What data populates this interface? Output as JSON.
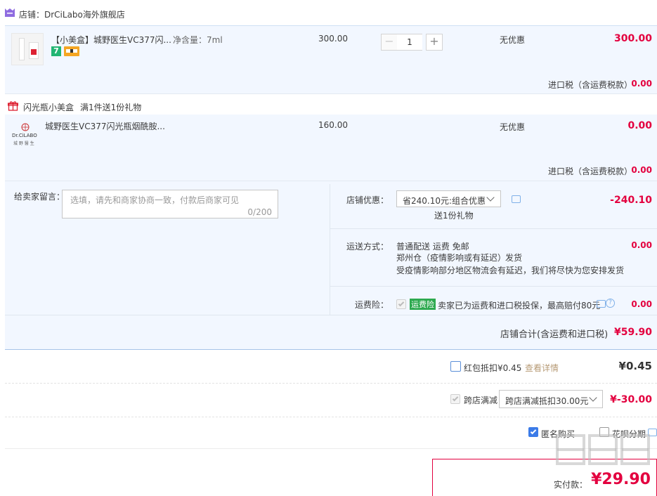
{
  "shop": {
    "name": "店铺：DrCiLabo海外旗舰店"
  },
  "items": [
    {
      "title": "【小美盒】城野医生VC377闪...",
      "spec": "净含量：7ml",
      "price": "300.00",
      "quantity": "1",
      "discount": "无优惠",
      "subtotal": "300.00",
      "tax_label": "进口税（含运费税款）",
      "tax_value": "0.00",
      "tag_number": "7"
    },
    {
      "promo_label": "闪光瓶小美盒",
      "promo_rule": "满1件送1份礼物",
      "title": "城野医生VC377闪光瓶烟酰胺...",
      "price": "160.00",
      "discount": "无优惠",
      "subtotal": "0.00",
      "tax_label": "进口税（含运费税款）",
      "tax_value": "0.00",
      "brand": "Dr.CiLABO",
      "brand_sub": "城 野 醫 生"
    }
  ],
  "message": {
    "label": "给卖家留言：",
    "placeholder": "选填，请先和商家协商一致，付款后商家可见",
    "counter": "0/200"
  },
  "shop_discount": {
    "label": "店铺优惠：",
    "selected": "省240.10元:组合优惠",
    "gift": "送1份礼物",
    "value": "-240.10"
  },
  "shipping": {
    "label": "运送方式：",
    "method": "普通配送 运费 免邮",
    "warehouse": "郑州仓（疫情影响或有延迟）",
    "ship_note": "发货",
    "notice": "受疫情影响部分地区物流会有延迟，我们将尽快为您安排发货",
    "value": "0.00"
  },
  "insurance": {
    "label": "运费险：",
    "tag": "运费险",
    "desc": "卖家已为运费和进口税投保，最高赔付80元",
    "value": "0.00"
  },
  "shop_total": {
    "label": "店铺合计(含运费和进口税)",
    "value": "¥59.90"
  },
  "red_packet": {
    "label": "红包抵扣¥0.45",
    "link": "查看详情",
    "value": "¥0.45"
  },
  "cross_store": {
    "label": "跨店满减",
    "selected": "跨店满减抵扣30.00元",
    "value": "¥-30.00"
  },
  "options": {
    "anonymous": "匿名购买",
    "huabei": "花呗分期"
  },
  "grand_total": {
    "label": "实付款：",
    "value": "¥29.90"
  },
  "watermark": "值 什么值得买",
  "colors": {
    "accent_red": "#e3003f",
    "panel_blue": "#f2f7ff",
    "link_gold": "#b79b76",
    "check_blue": "#3b7be8"
  }
}
